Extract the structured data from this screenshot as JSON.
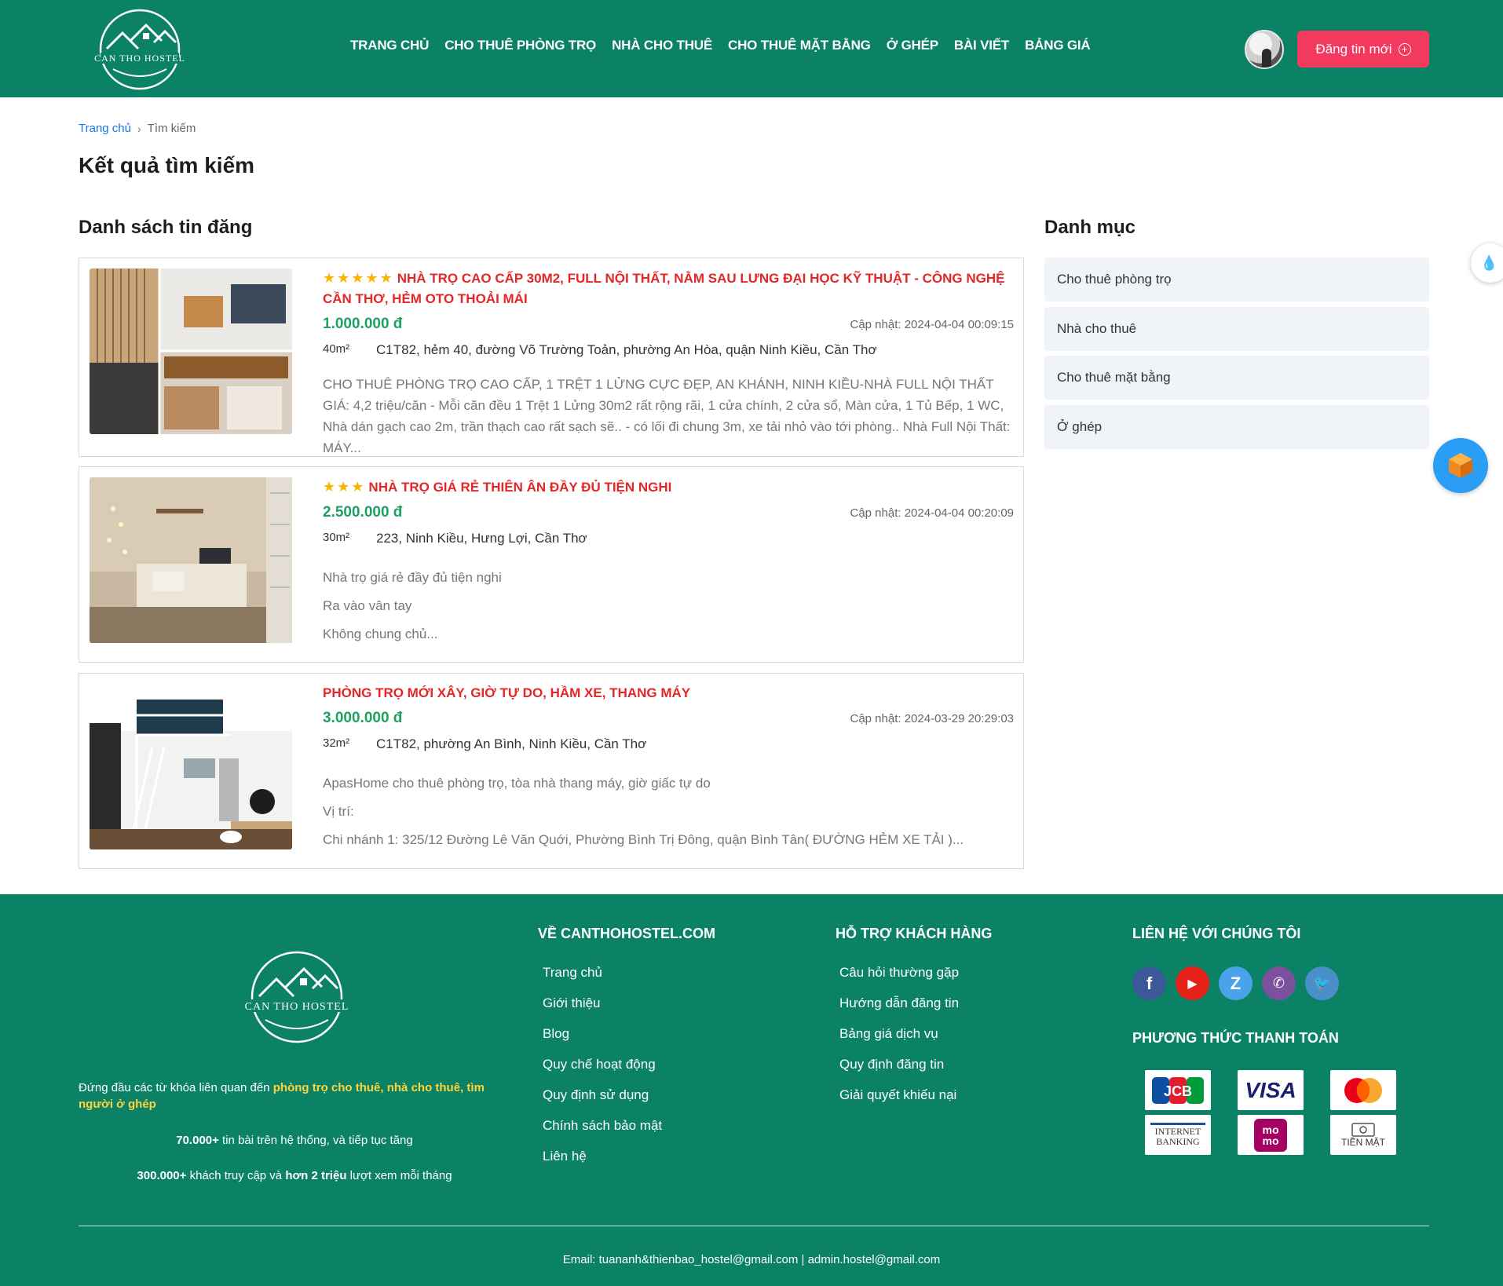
{
  "header": {
    "logo_text": "CAN THO HOSTEL",
    "nav": [
      "TRANG CHỦ",
      "CHO THUÊ PHÒNG TRỌ",
      "NHÀ CHO THUÊ",
      "CHO THUÊ MẶT BẰNG",
      "Ở GHÉP",
      "BÀI VIẾT",
      "BẢNG GIÁ"
    ],
    "post_button": "Đăng tin mới"
  },
  "breadcrumb": {
    "home": "Trang chủ",
    "current": "Tìm kiếm"
  },
  "page_title": "Kết quả tìm kiếm",
  "listing_section_title": "Danh sách tin đăng",
  "listings": [
    {
      "stars": "★★★★★",
      "title": "NHÀ TRỌ CAO CẤP 30M2, FULL NỘI THẤT, NẰM SAU LƯNG ĐẠI HỌC KỸ THUẬT - CÔNG NGHỆ CẦN THƠ, HẺM OTO THOẢI MÁI",
      "price": "1.000.000 đ",
      "updated": "Cập nhật: 2024-04-04 00:09:15",
      "area": "40m²",
      "address": "C1T82, hẻm 40, đường Võ Trường Toản, phường An Hòa, quận Ninh Kiều, Cần Thơ",
      "desc": [
        "CHO THUÊ PHÒNG TRỌ CAO CẤP, 1 TRỆT 1 LỬNG CỰC ĐẸP, AN KHÁNH, NINH KIỀU-NHÀ FULL NỘI THẤT GIÁ: 4,2 triệu/căn - Mỗi căn đều 1 Trệt 1 Lửng 30m2 rất rộng rãi, 1 cửa chính, 2 cửa sổ, Màn cửa, 1 Tủ Bếp, 1 WC, Nhà dán gạch cao 2m, trần thạch cao rất sạch sẽ.. - có lối đi chung 3m, xe tải nhỏ vào tới phòng.. Nhà Full Nội Thất: MÁY..."
      ]
    },
    {
      "stars": "★★★",
      "title": "NHÀ TRỌ GIÁ RẺ THIÊN ÂN ĐẦY ĐỦ TIỆN NGHI",
      "price": "2.500.000 đ",
      "updated": "Cập nhật: 2024-04-04 00:20:09",
      "area": "30m²",
      "address": "223, Ninh Kiều, Hưng Lợi, Cần Thơ",
      "desc": [
        "Nhà trọ giá rẻ đầy đủ tiện nghi",
        "Ra vào vân tay",
        "Không chung chủ..."
      ]
    },
    {
      "stars": "",
      "title": "PHÒNG TRỌ MỚI XÂY, GIỜ TỰ DO, HẦM XE, THANG MÁY",
      "price": "3.000.000 đ",
      "updated": "Cập nhật: 2024-03-29 20:29:03",
      "area": "32m²",
      "address": "C1T82, phường An Bình, Ninh Kiều, Cần Thơ",
      "desc": [
        "ApasHome cho thuê phòng trọ, tòa nhà thang máy, giờ giấc tự do",
        "Vị trí:",
        "Chi nhánh 1: 325/12 Đường Lê Văn Quới, Phường Bình Trị Đông, quận Bình Tân( ĐƯỜNG HẺM XE TẢI )..."
      ]
    }
  ],
  "categories": {
    "title": "Danh mục",
    "items": [
      "Cho thuê phòng trọ",
      "Nhà cho thuê",
      "Cho thuê mặt bằng",
      "Ở ghép"
    ]
  },
  "footer": {
    "logo_text": "CAN THO HOSTEL",
    "tagline_prefix": "Đứng đầu các từ khóa liên quan đến ",
    "tagline_kw1": "phòng trọ cho thuê",
    "tagline_sep1": ", ",
    "tagline_kw2": "nhà cho thuê",
    "tagline_sep2": ", ",
    "tagline_kw3": "tìm người ở ghép",
    "stat1_bold": "70.000+",
    "stat1_rest": " tin bài trên hệ thống, và tiếp tục tăng",
    "stat2_bold": "300.000+",
    "stat2_mid": " khách truy cập và ",
    "stat2_bold2": "hơn 2 triệu",
    "stat2_rest": " lượt xem mỗi tháng",
    "about_title": "VỀ CANTHOHOSTEL.COM",
    "about_links": [
      "Trang chủ",
      "Giới thiệu",
      "Blog",
      "Quy chế hoạt động",
      "Quy định sử dụng",
      "Chính sách bảo mật",
      "Liên hệ"
    ],
    "support_title": "HỖ TRỢ KHÁCH HÀNG",
    "support_links": [
      "Câu hỏi thường gặp",
      "Hướng dẫn đăng tin",
      "Bảng giá dịch vụ",
      "Quy định đăng tin",
      "Giải quyết khiếu nại"
    ],
    "contact_title": "LIÊN HỆ VỚI CHÚNG TÔI",
    "socials": [
      {
        "name": "facebook-icon",
        "glyph": "f",
        "color": "#3b5998"
      },
      {
        "name": "youtube-icon",
        "glyph": "▶",
        "color": "#e62117"
      },
      {
        "name": "zalo-icon",
        "glyph": "Z",
        "color": "#4aa3e8"
      },
      {
        "name": "viber-icon",
        "glyph": "✆",
        "color": "#7b519d"
      },
      {
        "name": "twitter-icon",
        "glyph": "🐦",
        "color": "#4a90c8"
      }
    ],
    "payment_title": "PHƯƠNG THỨC THANH TOÁN",
    "payments": [
      "JCB",
      "VISA",
      "mastercard",
      "INTERNET BANKING",
      "mo mo",
      "TIỀN MẶT"
    ],
    "email": "Email: tuananh&thienbao_hostel@gmail.com | admin.hostel@gmail.com"
  },
  "colors": {
    "brand": "#0b8266",
    "accent": "#f33a5e",
    "title_red": "#e32727",
    "price_green": "#20a061"
  }
}
